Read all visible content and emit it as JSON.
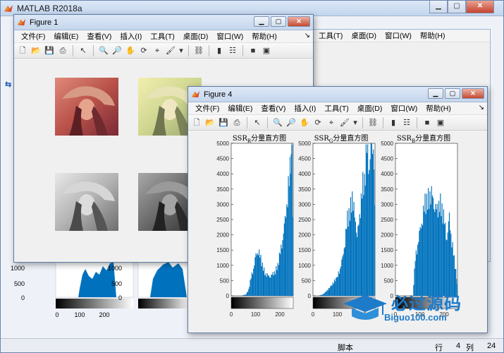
{
  "main_window": {
    "title": "MATLAB R2018a",
    "status_left": "脚本",
    "status_row_label": "行",
    "status_row": "4",
    "status_col_label": "列",
    "status_col": "24"
  },
  "figure1": {
    "title": "Figure 1",
    "menus": [
      "文件(F)",
      "编辑(E)",
      "查看(V)",
      "插入(I)",
      "工具(T)",
      "桌面(D)",
      "窗口(W)",
      "帮助(H)"
    ]
  },
  "figure4": {
    "title": "Figure 4",
    "menus": [
      "文件(F)",
      "编辑(E)",
      "查看(V)",
      "插入(I)",
      "工具(T)",
      "桌面(D)",
      "窗口(W)",
      "帮助(H)"
    ]
  },
  "background_figure": {
    "menus_visible": [
      "工具(T)",
      "桌面(D)",
      "窗口(W)",
      "帮助(H)"
    ],
    "ytick_labels": [
      "1000",
      "500",
      "0"
    ],
    "xtick_labels": [
      "0",
      "100",
      "200"
    ]
  },
  "watermark": {
    "text_cn": "必过源码",
    "text_en": "Biguo100.com"
  },
  "colors": {
    "bar_blue": "#0072bd",
    "title_bar": "#c5d6ec",
    "close_red": "#c64a32"
  },
  "chart_data": [
    {
      "type": "bar",
      "title": "SSR_R分量直方图",
      "title_main": "SSR",
      "title_sub": "R",
      "title_suffix": "分量直方图",
      "xlabel": "",
      "ylabel": "",
      "xlim": [
        0,
        255
      ],
      "ylim": [
        0,
        5000
      ],
      "yticks": [
        0,
        500,
        1000,
        1500,
        2000,
        2500,
        3000,
        3500,
        4000,
        4500,
        5000
      ],
      "xticks": [
        0,
        100,
        200
      ],
      "bins_x": [
        0,
        20,
        40,
        60,
        70,
        80,
        90,
        100,
        110,
        120,
        130,
        140,
        150,
        160,
        170,
        180,
        190,
        200,
        210,
        220,
        230,
        240,
        245,
        250,
        255
      ],
      "values": [
        0,
        0,
        0,
        50,
        200,
        600,
        900,
        1300,
        1500,
        1200,
        900,
        700,
        650,
        650,
        700,
        800,
        1000,
        1400,
        1900,
        2400,
        3300,
        4100,
        5000,
        4900,
        600
      ]
    },
    {
      "type": "bar",
      "title": "SSR_G分量直方图",
      "title_main": "SSR",
      "title_sub": "G",
      "title_suffix": "分量直方图",
      "xlabel": "",
      "ylabel": "",
      "xlim": [
        0,
        255
      ],
      "ylim": [
        0,
        5000
      ],
      "yticks": [
        0,
        500,
        1000,
        1500,
        2000,
        2500,
        3000,
        3500,
        4000,
        4500,
        5000
      ],
      "xticks": [
        0,
        100,
        200
      ],
      "bins_x": [
        0,
        20,
        40,
        60,
        80,
        100,
        110,
        120,
        130,
        140,
        150,
        160,
        170,
        180,
        190,
        200,
        210,
        220,
        230,
        240,
        250,
        255
      ],
      "values": [
        0,
        0,
        50,
        200,
        400,
        650,
        900,
        1200,
        1800,
        2500,
        2700,
        3300,
        2500,
        2100,
        2400,
        3600,
        3700,
        4800,
        4300,
        5000,
        4700,
        700
      ]
    },
    {
      "type": "bar",
      "title": "SSR_B分量直方图",
      "title_main": "SSR",
      "title_sub": "B",
      "title_suffix": "分量直方图",
      "xlabel": "",
      "ylabel": "",
      "xlim": [
        0,
        255
      ],
      "ylim": [
        0,
        5000
      ],
      "yticks": [
        0,
        500,
        1000,
        1500,
        2000,
        2500,
        3000,
        3500,
        4000,
        4500,
        5000
      ],
      "xticks": [
        0,
        100,
        200
      ],
      "bins_x": [
        0,
        20,
        40,
        60,
        70,
        80,
        90,
        100,
        110,
        120,
        130,
        140,
        150,
        160,
        170,
        180,
        190,
        200,
        210,
        220,
        230,
        240,
        250,
        255
      ],
      "values": [
        0,
        0,
        0,
        0,
        0,
        1200,
        1700,
        2100,
        2600,
        3000,
        3100,
        3300,
        3200,
        3000,
        2700,
        3100,
        2800,
        2400,
        1900,
        2500,
        1800,
        1200,
        600,
        100
      ]
    }
  ]
}
